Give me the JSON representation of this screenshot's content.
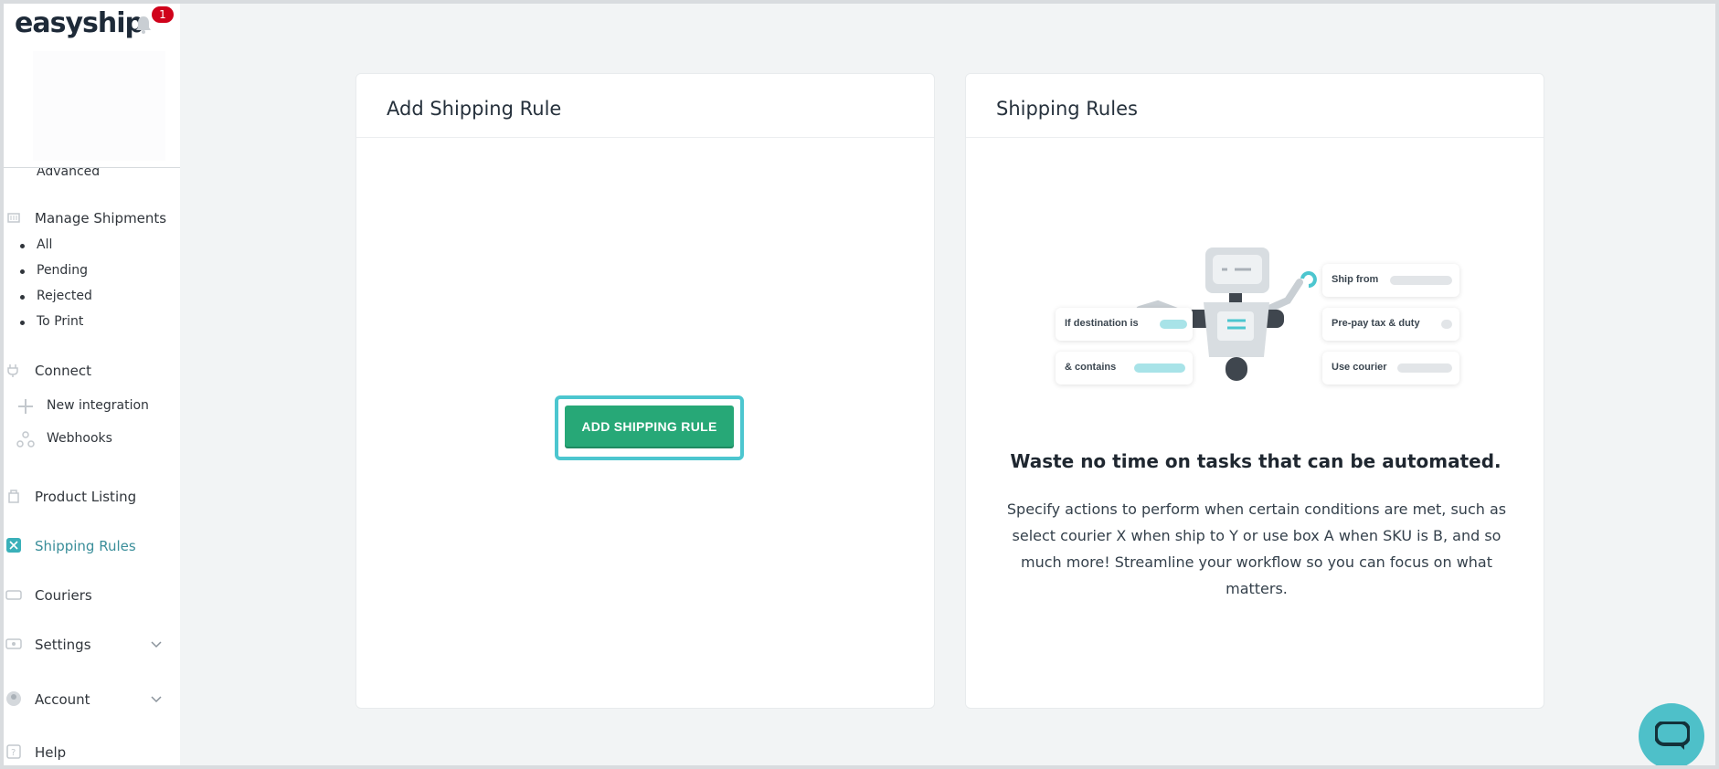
{
  "brand": {
    "logo_text": "easyship",
    "notification_count": "1"
  },
  "sidebar": {
    "advanced_label": "Advanced",
    "manage_shipments": "Manage Shipments",
    "shipment_subitems": [
      "All",
      "Pending",
      "Rejected",
      "To Print"
    ],
    "connect": "Connect",
    "new_integration": "New integration",
    "webhooks": "Webhooks",
    "product_listing": "Product Listing",
    "shipping_rules": "Shipping Rules",
    "couriers": "Couriers",
    "settings": "Settings",
    "account": "Account",
    "help": "Help"
  },
  "left_card": {
    "title": "Add Shipping Rule",
    "button_label": "ADD SHIPPING RULE"
  },
  "right_card": {
    "title": "Shipping Rules",
    "pills": {
      "if_destination": "If destination is",
      "contains": "& contains",
      "ship_from": "Ship from",
      "prepay": "Pre-pay tax & duty",
      "use_courier": "Use courier"
    },
    "headline": "Waste no time on tasks that can be automated.",
    "description": "Specify actions to perform when certain conditions are met, such as select courier X when ship to Y or use box A when SKU is B, and so much more! Streamline your workflow so you can focus on what matters."
  },
  "colors": {
    "accent": "#4cc6cf",
    "primary_button": "#27a877",
    "active_nav": "#3a8e9a",
    "badge": "#d0021b"
  },
  "icons": [
    "bell-icon",
    "shipments-icon",
    "plug-icon",
    "plus-icon",
    "webhooks-icon",
    "product-listing-icon",
    "shipping-rules-icon",
    "couriers-icon",
    "settings-icon",
    "account-icon",
    "help-icon",
    "chevron-down-icon",
    "chat-icon"
  ]
}
